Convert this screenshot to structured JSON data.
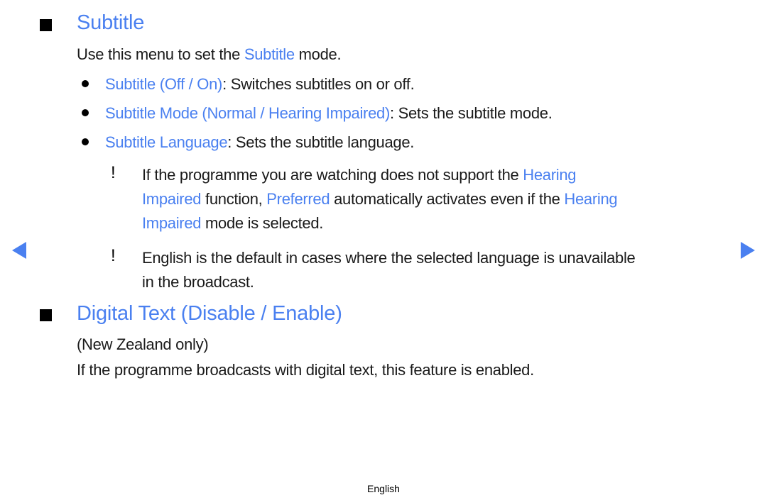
{
  "sections": [
    {
      "title": "Subtitle",
      "intro": {
        "pre": "Use this menu to set the ",
        "hl": "Subtitle",
        "post": " mode."
      },
      "bullets": [
        {
          "term": "Subtitle (Off / On)",
          "desc": ": Switches subtitles on or off."
        },
        {
          "term": "Subtitle Mode (Normal / Hearing Impaired)",
          "desc": ": Sets the subtitle mode."
        },
        {
          "term": "Subtitle Language",
          "desc": ": Sets the subtitle language."
        }
      ],
      "notes": [
        {
          "mark": "!",
          "line1": {
            "a": "If the programme you are watching does not support the ",
            "b": "Hearing"
          },
          "line2": {
            "a": "Impaired",
            "b": " function, ",
            "c": "Preferred",
            "d": " automatically activates even if the ",
            "e": "Hearing"
          },
          "line3": {
            "a": "Impaired",
            "b": " mode is selected."
          }
        },
        {
          "mark": "!",
          "line1": "English is the default in cases where the selected language is unavailable",
          "line2": "in the broadcast."
        }
      ]
    },
    {
      "title": "Digital Text (Disable / Enable)",
      "lines": [
        "(New Zealand only)",
        "If the programme broadcasts with digital text, this feature is enabled."
      ]
    }
  ],
  "navigation": {
    "prev": "previous-page",
    "next": "next-page"
  },
  "footer": {
    "language": "English"
  },
  "colors": {
    "accent": "#4a80f0",
    "text": "#1a1a1a"
  }
}
